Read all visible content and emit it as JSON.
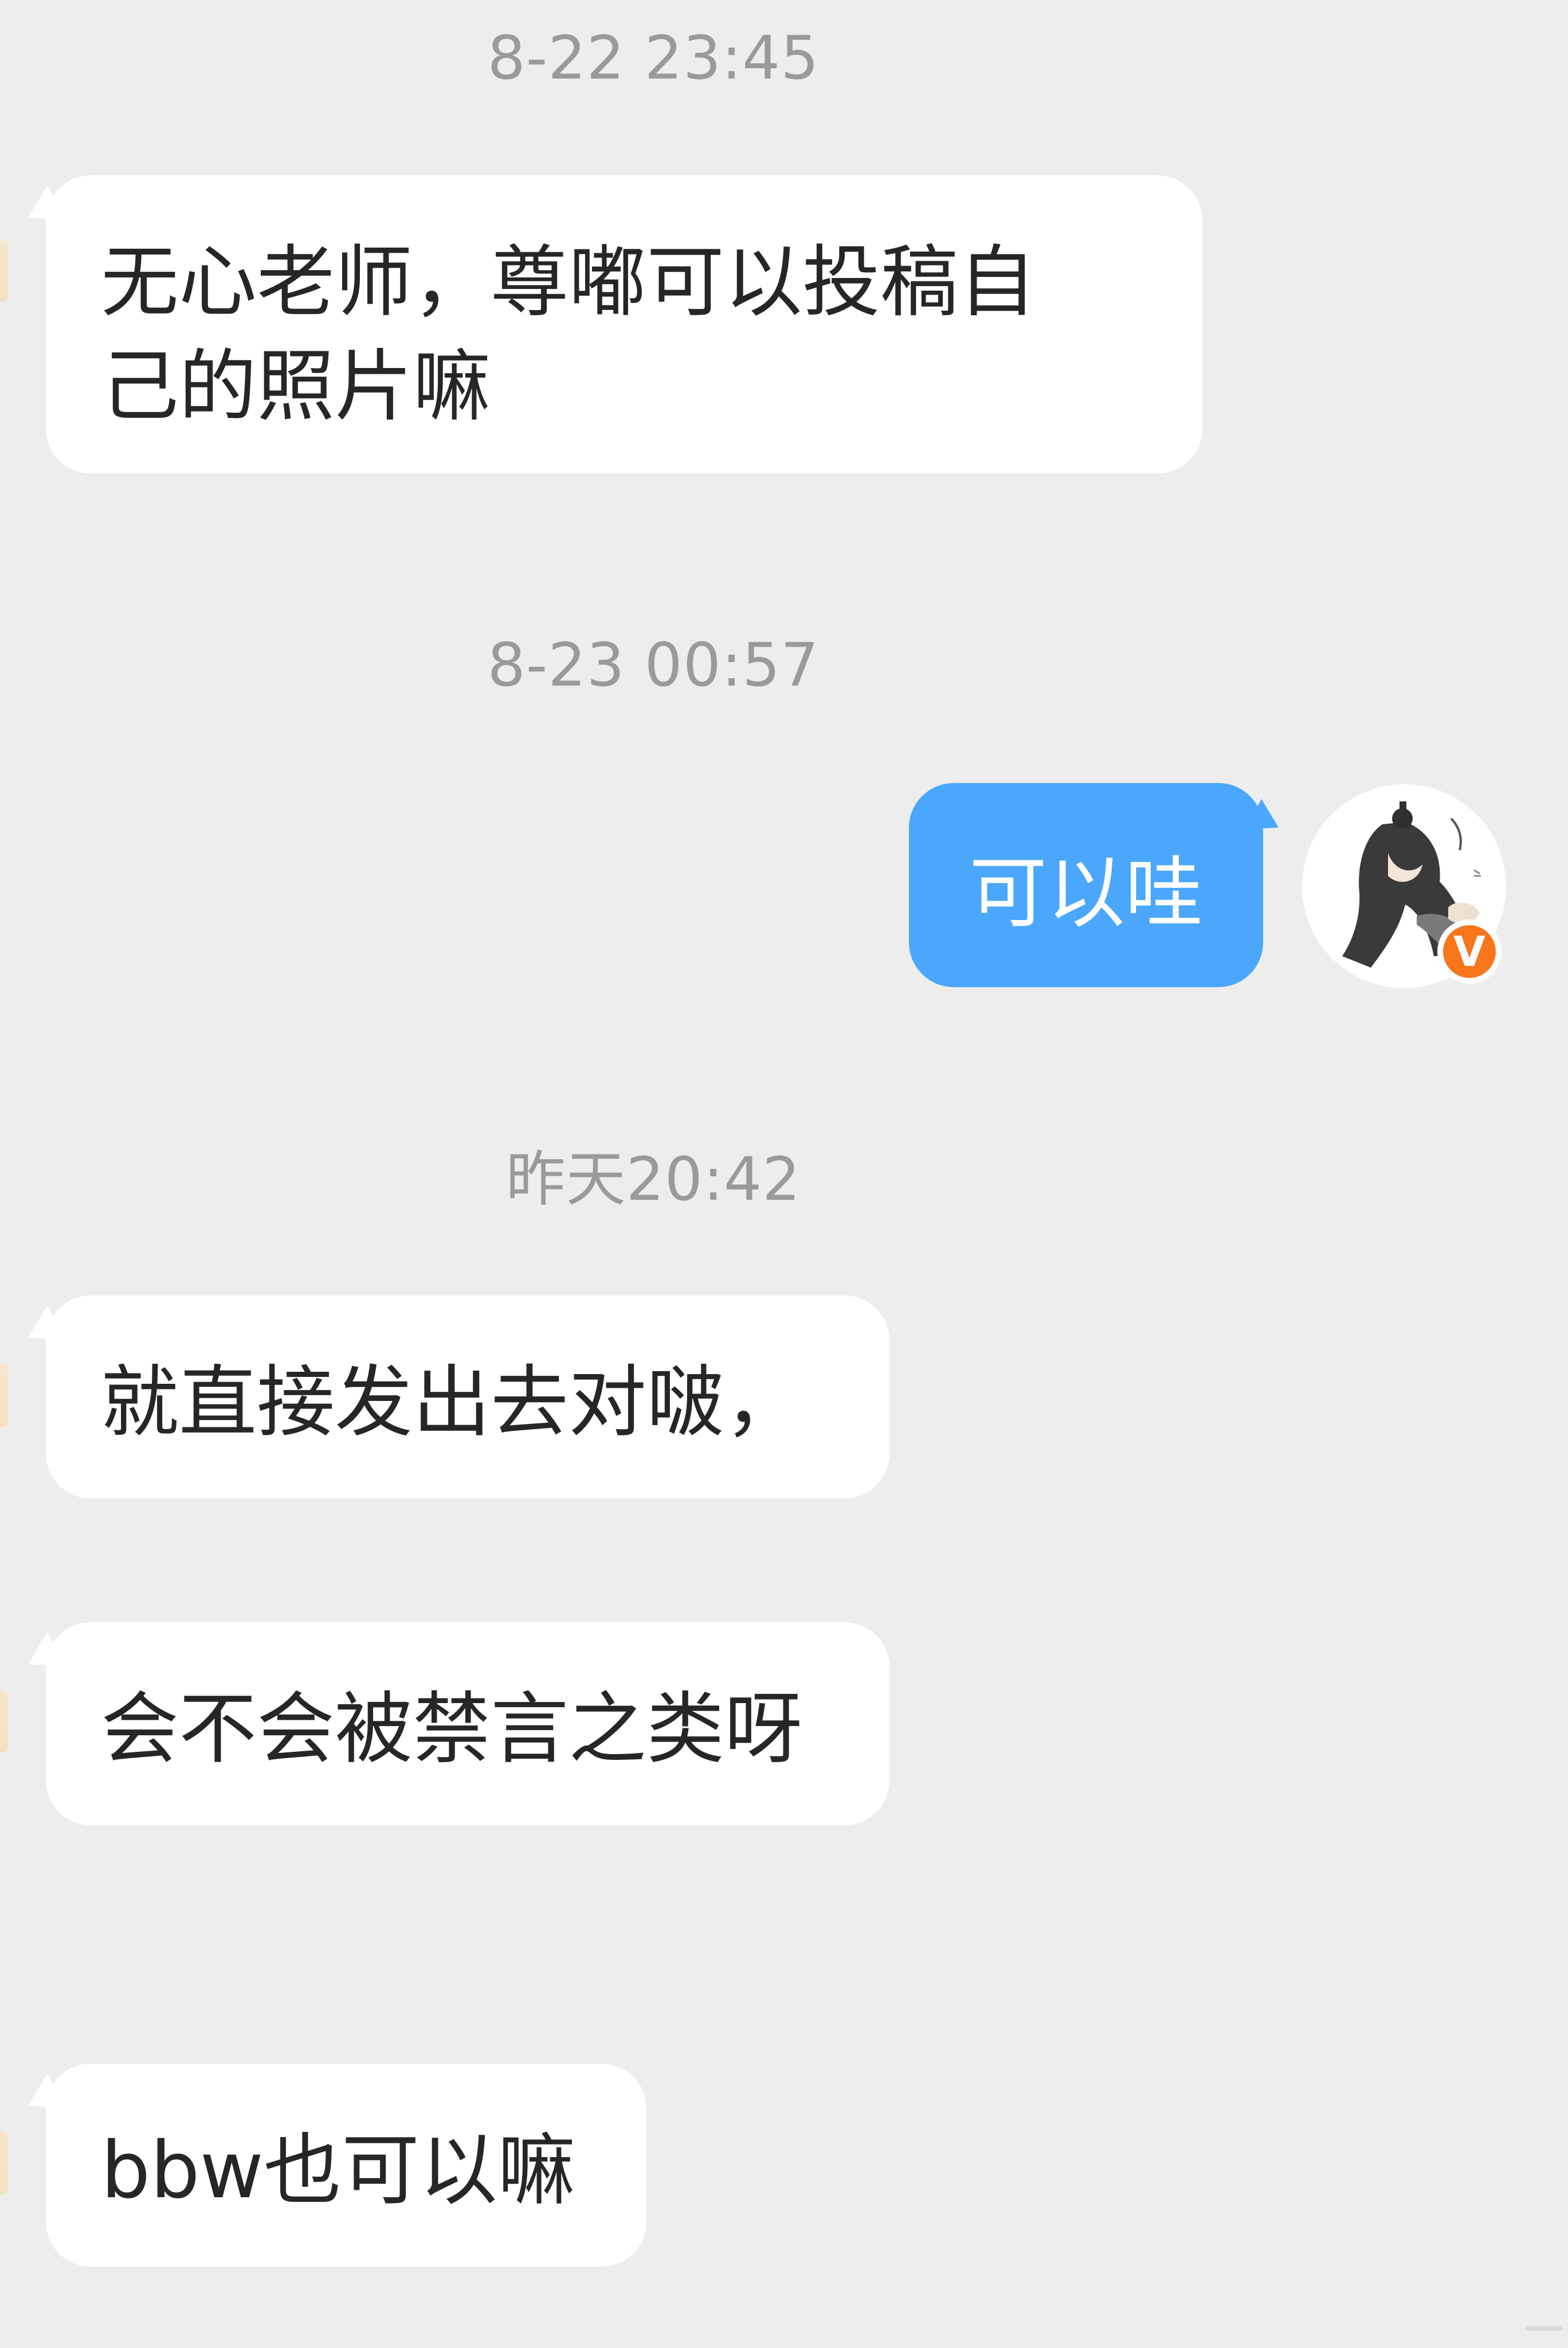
{
  "chat": {
    "timestamps": [
      "8-22 23:45",
      "8-23 00:57",
      "昨天20:42"
    ],
    "messages": [
      {
        "direction": "incoming",
        "lines": [
          "无心老师，尊嘟可以投稿自",
          "己的照片嘛"
        ]
      },
      {
        "direction": "outgoing",
        "lines": [
          "可以哇"
        ]
      },
      {
        "direction": "incoming",
        "lines": [
          "就直接发出去对啵，"
        ]
      },
      {
        "direction": "incoming",
        "lines": [
          "会不会被禁言之类呀"
        ]
      },
      {
        "direction": "incoming",
        "lines": [
          "bbw也可以嘛"
        ]
      }
    ]
  },
  "avatar": {
    "badge_text": "V",
    "badge_color": "#f7761c"
  },
  "colors": {
    "background": "#ededed",
    "incoming_bubble": "#ffffff",
    "outgoing_bubble": "#4aa7fb",
    "timestamp_text": "#9a9a9a"
  },
  "icons": [
    "user-avatar-icon",
    "verified-badge-icon"
  ]
}
